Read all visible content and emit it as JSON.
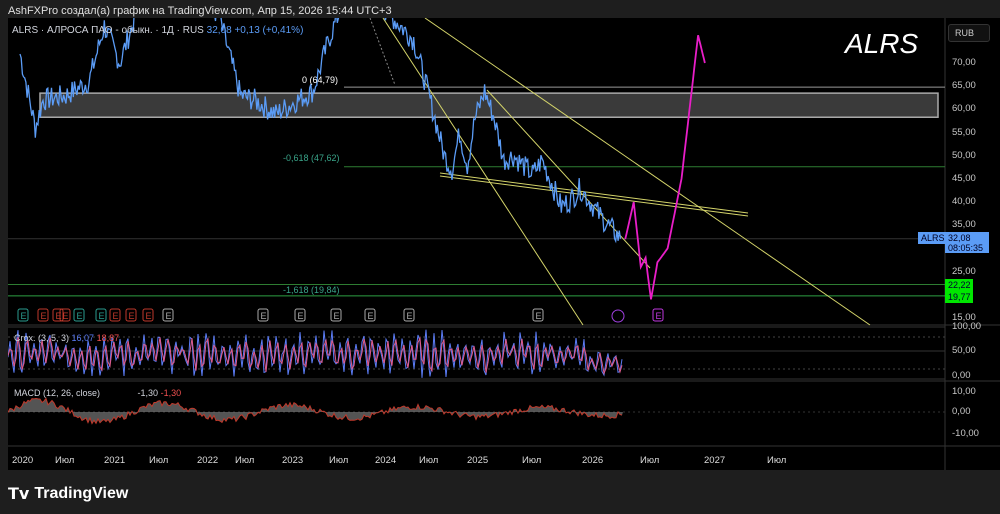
{
  "credit": "AshFXPro создал(а) график на TradingView.com, Апр 15, 2026 15:44 UTC+3",
  "legend": {
    "symbol": "ALRS",
    "name": "АЛРОСА ПАО - обыкн.",
    "interval": "1Д",
    "exchange": "RUS",
    "price": "32,08",
    "change": "+0,13",
    "change_pct": "(+0,41%)"
  },
  "watermark": "ALRS",
  "currency": "RUB",
  "price_axis": [
    "70,00",
    "65,00",
    "60,00",
    "55,00",
    "50,00",
    "45,00",
    "40,00",
    "35,00",
    "25,00",
    "15,00"
  ],
  "price_tag": {
    "symbol": "ALRS",
    "price": "32,08",
    "countdown": "08:05:35"
  },
  "level_tags": [
    "22,22",
    "19,77"
  ],
  "fib_labels": {
    "f0": "0 (64,79)",
    "f618": "-0,618 (47,62)",
    "f1618": "-1,618 (19,84)"
  },
  "stoch": {
    "label": "Crox. (3, 5, 3)",
    "k": "16,07",
    "d": "18,87",
    "axis": [
      "100,00",
      "50,00",
      "0,00"
    ]
  },
  "macd": {
    "label": "MACD (12, 26, close)",
    "v1": "-1,30",
    "v2": "-1,30",
    "axis": [
      "10,00",
      "0,00",
      "-10,00"
    ]
  },
  "time_axis": [
    "2020",
    "Июл",
    "2021",
    "Июл",
    "2022",
    "Июл",
    "2023",
    "Июл",
    "2024",
    "Июл",
    "2025",
    "Июл",
    "2026",
    "Июл",
    "2027",
    "Июл"
  ],
  "brand": "TradingView",
  "colors": {
    "price": "#5b9cf6",
    "projection": "#e91ec8",
    "zone": "#3a3a3a",
    "trendline": "#d4d46a",
    "fib": "#2e7d32",
    "tag_green": "#00e600"
  },
  "chart_data": {
    "type": "line",
    "price": [
      [
        "2020-01",
        72
      ],
      [
        "2020-03",
        56
      ],
      [
        "2020-04",
        62
      ],
      [
        "2020-07",
        63
      ],
      [
        "2020-10",
        66
      ],
      [
        "2020-12",
        78
      ],
      [
        "2021-02",
        70
      ],
      [
        "2021-05",
        85
      ],
      [
        "2021-10",
        90
      ],
      [
        "2022-03",
        80
      ],
      [
        "2022-06",
        63
      ],
      [
        "2022-08",
        62
      ],
      [
        "2022-11",
        59
      ],
      [
        "2023-02",
        62
      ],
      [
        "2023-04",
        64
      ],
      [
        "2023-06",
        75
      ],
      [
        "2023-09",
        88
      ],
      [
        "2024-01",
        82
      ],
      [
        "2024-05",
        75
      ],
      [
        "2024-07",
        63
      ],
      [
        "2024-09",
        50
      ],
      [
        "2024-10",
        47
      ],
      [
        "2024-11",
        55
      ],
      [
        "2024-12",
        48
      ],
      [
        "2025-01",
        58
      ],
      [
        "2025-02",
        64
      ],
      [
        "2025-03",
        58
      ],
      [
        "2025-04",
        49
      ],
      [
        "2025-05",
        50
      ],
      [
        "2025-07",
        46
      ],
      [
        "2025-08",
        49
      ],
      [
        "2025-09",
        44
      ],
      [
        "2025-10",
        39
      ],
      [
        "2025-11",
        40.5
      ],
      [
        "2025-12",
        43
      ],
      [
        "2026-02",
        37
      ],
      [
        "2026-04",
        32.08
      ]
    ],
    "projection": [
      [
        "2026-04-15",
        32
      ],
      [
        "2026-05-10",
        40
      ],
      [
        "2026-06-01",
        26
      ],
      [
        "2026-06-15",
        28
      ],
      [
        "2026-07-01",
        19
      ],
      [
        "2026-07-20",
        27
      ],
      [
        "2026-08-20",
        30
      ],
      [
        "2026-10-01",
        45
      ],
      [
        "2026-11-01",
        64
      ],
      [
        "2026-11-20",
        76
      ],
      [
        "2026-12-10",
        70
      ]
    ],
    "zone": [
      58.3,
      63.5
    ],
    "levels": [
      64.79,
      47.62,
      32.08,
      22.22,
      19.77
    ],
    "ylim": [
      15,
      70
    ]
  }
}
